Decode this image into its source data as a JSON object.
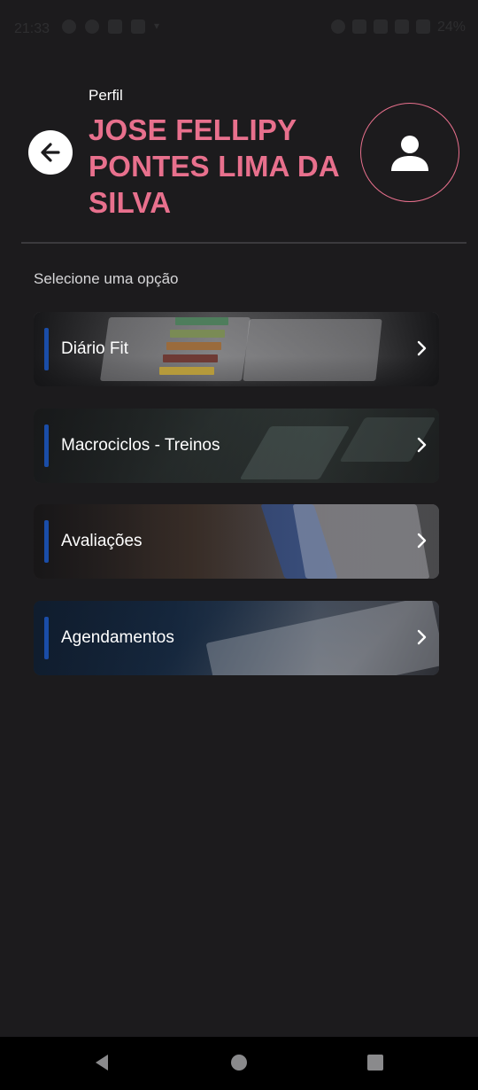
{
  "status_bar": {
    "time": "21:33",
    "battery": "24%",
    "left_icons": [
      "whatsapp-icon",
      "instagram-icon",
      "phone-icon",
      "gallery-icon",
      "arrow-icon"
    ],
    "right_icons": [
      "alarm-icon",
      "bluetooth-icon",
      "vibrate-icon",
      "data-icon",
      "signal-icon",
      "battery-icon"
    ]
  },
  "header": {
    "subtitle": "Perfil",
    "user_name": "JOSE FELLIPY PONTES LIMA DA SILVA",
    "back_icon": "arrow-left-icon",
    "avatar_icon": "user-icon"
  },
  "section_label": "Selecione uma opção",
  "menu": [
    {
      "label": "Diário Fit",
      "icon": "chevron-right-icon"
    },
    {
      "label": "Macrociclos - Treinos",
      "icon": "chevron-right-icon"
    },
    {
      "label": "Avaliações",
      "icon": "chevron-right-icon"
    },
    {
      "label": "Agendamentos",
      "icon": "chevron-right-icon"
    }
  ],
  "colors": {
    "background": "#1c1b1d",
    "accent_pink": "#e8708d",
    "accent_blue": "#1a4da8",
    "divider": "#3b3a3d"
  },
  "nav_bar": [
    "back-triangle-icon",
    "home-circle-icon",
    "recents-square-icon"
  ]
}
